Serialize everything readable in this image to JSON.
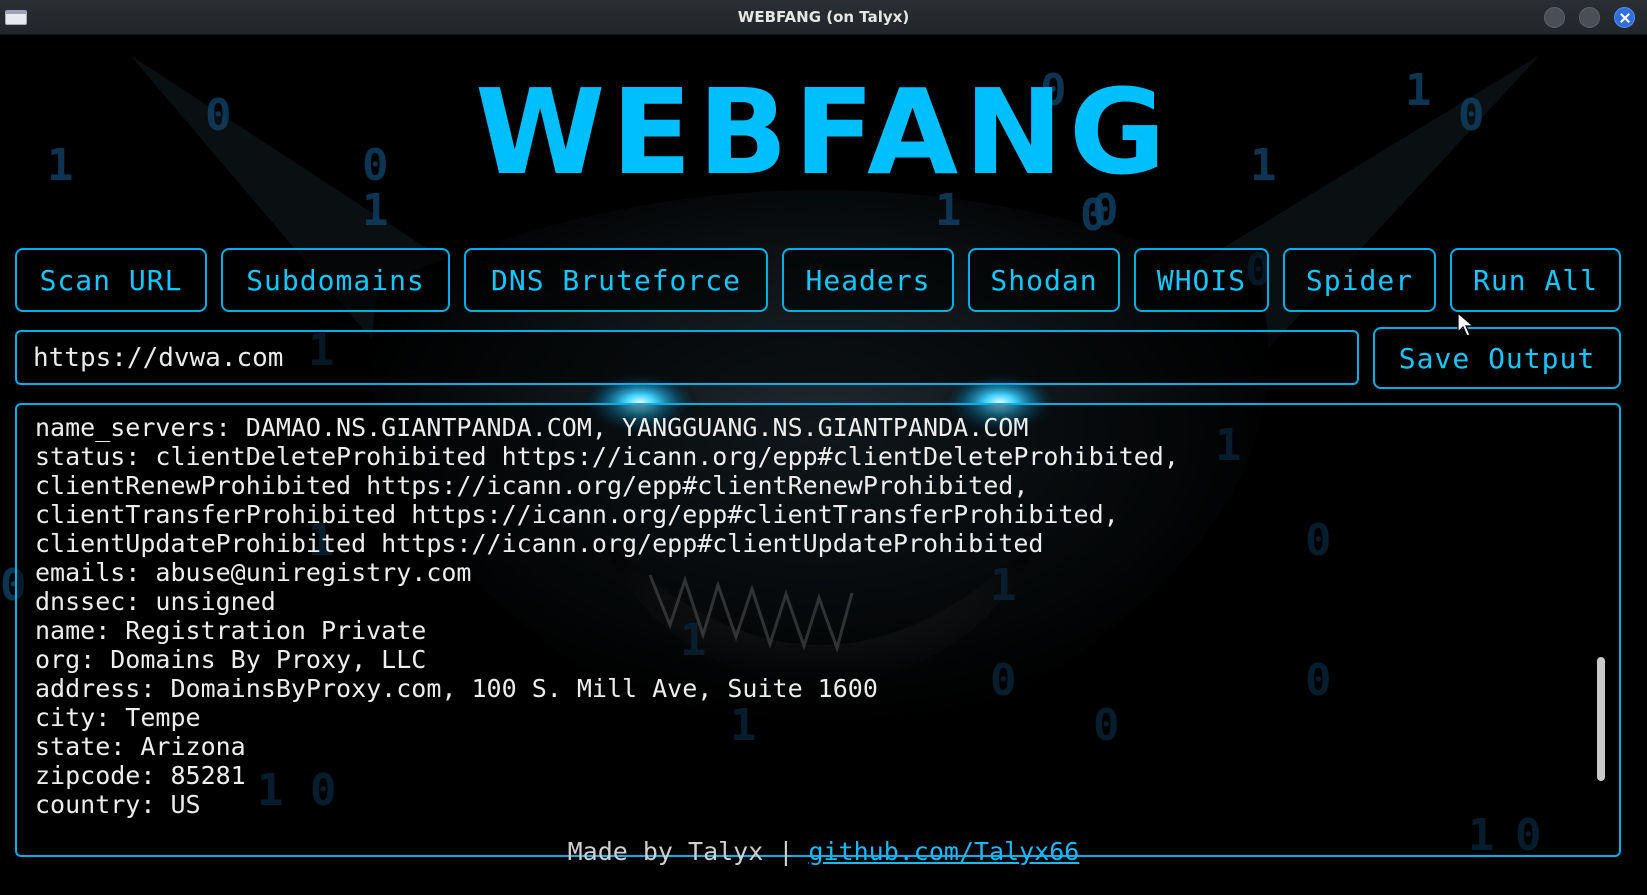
{
  "window": {
    "title": "WEBFANG (on Talyx)"
  },
  "brand": {
    "title": "WEBFANG",
    "color": "#00bfff"
  },
  "background_digits": [
    "0",
    "1",
    "0",
    "1",
    "0",
    "0",
    "1",
    "0",
    "1",
    "1",
    "0",
    "0",
    "1",
    "1",
    "0",
    "1",
    "0",
    "1",
    "0",
    "0",
    "1",
    "0",
    "1",
    "0",
    "1",
    "0",
    "1"
  ],
  "toolbar": {
    "buttons": [
      {
        "label": "Scan URL"
      },
      {
        "label": "Subdomains"
      },
      {
        "label": "DNS Bruteforce"
      },
      {
        "label": "Headers"
      },
      {
        "label": "Shodan"
      },
      {
        "label": "WHOIS"
      },
      {
        "label": "Spider"
      },
      {
        "label": "Run All"
      }
    ]
  },
  "url_input": {
    "value": "https://dvwa.com"
  },
  "save_button": {
    "label": "Save Output"
  },
  "output": {
    "lines": [
      "name_servers: DAMAO.NS.GIANTPANDA.COM, YANGGUANG.NS.GIANTPANDA.COM",
      "status: clientDeleteProhibited https://icann.org/epp#clientDeleteProhibited,",
      "clientRenewProhibited https://icann.org/epp#clientRenewProhibited,",
      "clientTransferProhibited https://icann.org/epp#clientTransferProhibited,",
      "clientUpdateProhibited https://icann.org/epp#clientUpdateProhibited",
      "emails: abuse@uniregistry.com",
      "dnssec: unsigned",
      "name: Registration Private",
      "org: Domains By Proxy, LLC",
      "address: DomainsByProxy.com, 100 S. Mill Ave, Suite 1600",
      "city: Tempe",
      "state: Arizona",
      "zipcode: 85281",
      "country: US"
    ]
  },
  "footer": {
    "text": "Made by Talyx | ",
    "link": "github.com/Talyx66"
  },
  "colors": {
    "accent": "#00aee8",
    "button_text": "#12c8ff",
    "eye_glow": "#3fd2ff",
    "digit": "#0f3f63"
  }
}
